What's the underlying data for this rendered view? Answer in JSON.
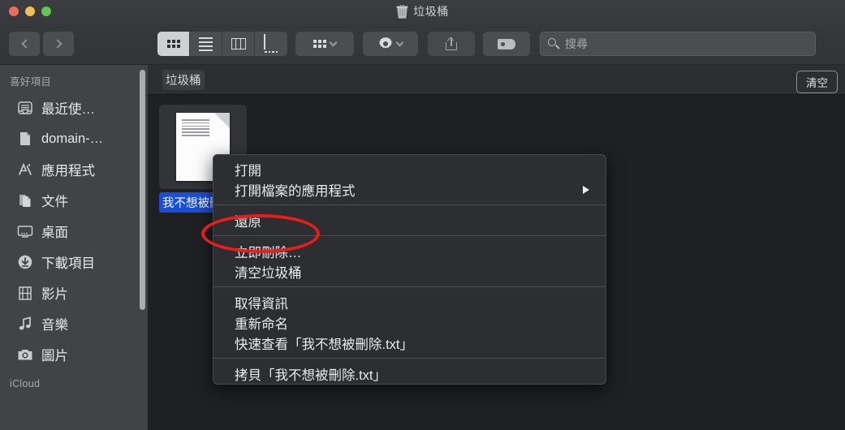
{
  "window": {
    "title": "垃圾桶",
    "title_icon": "trash-icon",
    "traffic_lights": {
      "close": "#ed6a5e",
      "minimize": "#f4bf4f",
      "zoom": "#61c554"
    }
  },
  "toolbar": {
    "back_icon": "chevron-left-icon",
    "forward_icon": "chevron-right-icon",
    "view_modes": [
      {
        "name": "icon-view",
        "icon": "grid-icon",
        "active": true
      },
      {
        "name": "list-view",
        "icon": "list-icon",
        "active": false
      },
      {
        "name": "column-view",
        "icon": "columns-icon",
        "active": false
      },
      {
        "name": "gallery-view",
        "icon": "gallery-icon",
        "active": false
      }
    ],
    "arrange_icon": "grid-icon",
    "action_icon": "gear-icon",
    "share_icon": "share-icon",
    "tags_icon": "tag-icon",
    "dropdown_icon": "chevron-down-icon"
  },
  "search": {
    "icon": "search-icon",
    "placeholder": "搜尋",
    "value": ""
  },
  "sidebar": {
    "sections": [
      {
        "header": "喜好項目",
        "items": [
          {
            "label": "最近使…",
            "icon": "recents-icon"
          },
          {
            "label": "domain-…",
            "icon": "document-icon"
          },
          {
            "label": "應用程式",
            "icon": "applications-icon"
          },
          {
            "label": "文件",
            "icon": "documents-icon"
          },
          {
            "label": "桌面",
            "icon": "desktop-icon"
          },
          {
            "label": "下載項目",
            "icon": "downloads-icon"
          },
          {
            "label": "影片",
            "icon": "movies-icon"
          },
          {
            "label": "音樂",
            "icon": "music-icon"
          },
          {
            "label": "圖片",
            "icon": "pictures-icon"
          }
        ]
      },
      {
        "header": "iCloud",
        "items": []
      }
    ]
  },
  "pathbar": {
    "current": "垃圾桶",
    "empty_button": "清空"
  },
  "files": [
    {
      "name": "我不想被刪除.txt",
      "display_label": "我不想被刪除.txt",
      "icon": "text-document-icon",
      "selected": true
    }
  ],
  "context_menu": {
    "groups": [
      {
        "items": [
          {
            "label": "打開",
            "submenu": false
          },
          {
            "label": "打開檔案的應用程式",
            "submenu": true
          }
        ]
      },
      {
        "items": [
          {
            "label": "還原",
            "submenu": false,
            "highlighted": true
          }
        ]
      },
      {
        "items": [
          {
            "label": "立即刪除…",
            "submenu": false
          },
          {
            "label": "清空垃圾桶",
            "submenu": false
          }
        ]
      },
      {
        "items": [
          {
            "label": "取得資訊",
            "submenu": false
          },
          {
            "label": "重新命名",
            "submenu": false
          },
          {
            "label": "快速查看「我不想被刪除.txt」",
            "submenu": false
          }
        ]
      },
      {
        "items": [
          {
            "label": "拷貝「我不想被刪除.txt」",
            "submenu": false
          }
        ]
      }
    ]
  },
  "annotation": {
    "shape": "ellipse",
    "color": "#ee1b1b",
    "target": "還原"
  }
}
